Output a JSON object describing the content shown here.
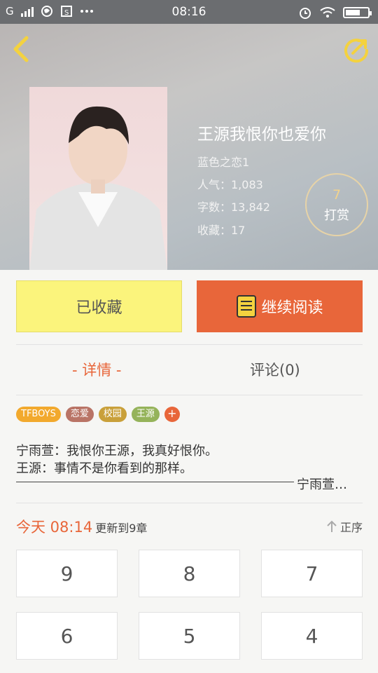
{
  "status_bar": {
    "carrier": "G",
    "time": "08:16",
    "icons": [
      "signal-icon",
      "browser-icon",
      "screenshot-icon",
      "more-icon",
      "alarm-icon",
      "wifi-icon",
      "battery-icon"
    ]
  },
  "header": {
    "title": "王源我恨你也爱你",
    "author": "蓝色之恋1",
    "popularity": "人气：1,083",
    "word_count": "字数：13,842",
    "favorites": "收藏：17",
    "reward_count": "7",
    "reward_label": "打赏"
  },
  "actions": {
    "favorite_label": "已收藏",
    "read_label": "继续阅读"
  },
  "tabs": {
    "detail": "- 详情 -",
    "comments": "评论(0)"
  },
  "tags": [
    {
      "label": "TFBOYS",
      "color": "#f2a92d"
    },
    {
      "label": "恋爱",
      "color": "#b97466"
    },
    {
      "label": "校园",
      "color": "#c9a03a"
    },
    {
      "label": "王源",
      "color": "#95b35a"
    }
  ],
  "tag_add": "+",
  "description": {
    "line1": "宁雨萱：我恨你王源，我真好恨你。",
    "line2": "王源：事情不是你看到的那样。",
    "line3": "宁雨萱…"
  },
  "update": {
    "time": "今天 08:14",
    "info": "更新到9章",
    "sort_label": "正序"
  },
  "chapters": [
    "9",
    "8",
    "7",
    "6",
    "5",
    "4"
  ],
  "colors": {
    "accent": "#e8663a",
    "favorite_bg": "#fbf47c",
    "status_bar": "#6b6d70"
  }
}
